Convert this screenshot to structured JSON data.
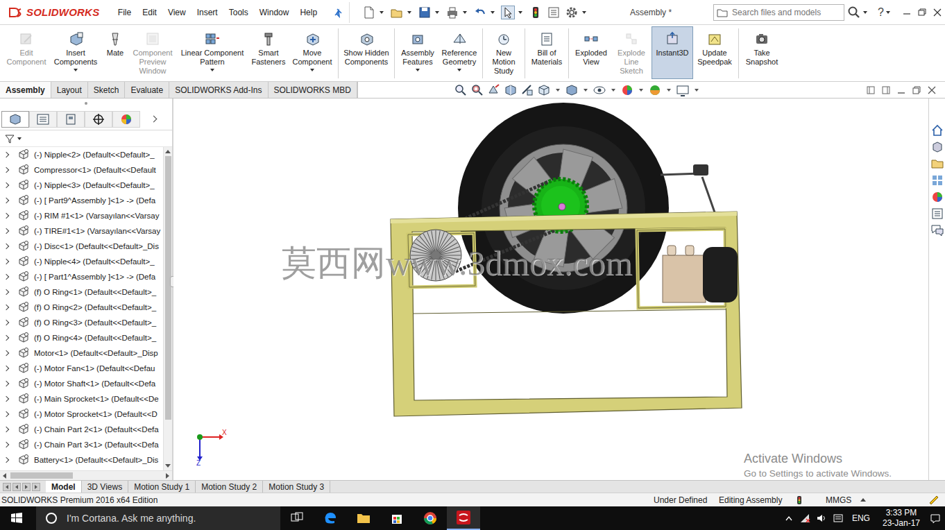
{
  "app": {
    "logo": "SOLIDWORKS",
    "title": "Assembly *",
    "help": "?"
  },
  "menu": [
    "File",
    "Edit",
    "View",
    "Insert",
    "Tools",
    "Window",
    "Help"
  ],
  "search": {
    "placeholder": "Search files and models"
  },
  "command_manager": [
    {
      "label": "Edit Component",
      "disabled": true,
      "selected": false,
      "has_menu": false
    },
    {
      "label": "Insert Components",
      "disabled": false,
      "selected": false,
      "has_menu": true
    },
    {
      "label": "Mate",
      "disabled": false,
      "selected": false,
      "has_menu": false
    },
    {
      "label": "Component Preview Window",
      "disabled": true,
      "selected": false,
      "has_menu": false
    },
    {
      "label": "Linear Component Pattern",
      "disabled": false,
      "selected": false,
      "has_menu": true
    },
    {
      "label": "Smart Fasteners",
      "disabled": false,
      "selected": false,
      "has_menu": false
    },
    {
      "label": "Move Component",
      "disabled": false,
      "selected": false,
      "has_menu": true
    },
    {
      "label": "Show Hidden Components",
      "disabled": false,
      "selected": false,
      "has_menu": false
    },
    {
      "label": "Assembly Features",
      "disabled": false,
      "selected": false,
      "has_menu": true
    },
    {
      "label": "Reference Geometry",
      "disabled": false,
      "selected": false,
      "has_menu": true
    },
    {
      "label": "New Motion Study",
      "disabled": false,
      "selected": false,
      "has_menu": false
    },
    {
      "label": "Bill of Materials",
      "disabled": false,
      "selected": false,
      "has_menu": false
    },
    {
      "label": "Exploded View",
      "disabled": false,
      "selected": false,
      "has_menu": false
    },
    {
      "label": "Explode Line Sketch",
      "disabled": true,
      "selected": false,
      "has_menu": false
    },
    {
      "label": "Instant3D",
      "disabled": false,
      "selected": true,
      "has_menu": false
    },
    {
      "label": "Update Speedpak",
      "disabled": false,
      "selected": false,
      "has_menu": false
    },
    {
      "label": "Take Snapshot",
      "disabled": false,
      "selected": false,
      "has_menu": false
    }
  ],
  "tabs": [
    {
      "label": "Assembly",
      "selected": true
    },
    {
      "label": "Layout",
      "selected": false
    },
    {
      "label": "Sketch",
      "selected": false
    },
    {
      "label": "Evaluate",
      "selected": false
    },
    {
      "label": "SOLIDWORKS Add-Ins",
      "selected": false
    },
    {
      "label": "SOLIDWORKS MBD",
      "selected": false
    }
  ],
  "panel_tabs": [
    {
      "selected": true
    },
    {
      "selected": false
    },
    {
      "selected": false
    },
    {
      "selected": false
    },
    {
      "selected": false
    }
  ],
  "tree": [
    {
      "label": "(-) Nipple<2> (Default<<Default>_",
      "expanded": false
    },
    {
      "label": "Compressor<1> (Default<<Default",
      "expanded": false
    },
    {
      "label": "(-) Nipple<3> (Default<<Default>_",
      "expanded": false
    },
    {
      "label": "(-) [ Part9^Assembly ]<1> -> (Defa",
      "expanded": false
    },
    {
      "label": "(-) RIM #1<1> (Varsayılan<<Varsay",
      "expanded": false
    },
    {
      "label": "(-) TIRE#1<1> (Varsayılan<<Varsay",
      "expanded": false
    },
    {
      "label": "(-) Disc<1> (Default<<Default>_Dis",
      "expanded": false
    },
    {
      "label": "(-) Nipple<4> (Default<<Default>_",
      "expanded": false
    },
    {
      "label": "(-) [ Part1^Assembly ]<1> -> (Defa",
      "expanded": false
    },
    {
      "label": "(f) O Ring<1> (Default<<Default>_",
      "expanded": false
    },
    {
      "label": "(f) O Ring<2> (Default<<Default>_",
      "expanded": false
    },
    {
      "label": "(f) O Ring<3> (Default<<Default>_",
      "expanded": false
    },
    {
      "label": "(f) O Ring<4> (Default<<Default>_",
      "expanded": false
    },
    {
      "label": "Motor<1> (Default<<Default>_Disp",
      "expanded": false
    },
    {
      "label": "(-) Motor Fan<1> (Default<<Defau",
      "expanded": false
    },
    {
      "label": "(-) Motor Shaft<1> (Default<<Defa",
      "expanded": false
    },
    {
      "label": "(-) Main Sprocket<1> (Default<<De",
      "expanded": false
    },
    {
      "label": "(-) Motor Sprocket<1> (Default<<D",
      "expanded": false
    },
    {
      "label": "(-) Chain Part 2<1> (Default<<Defa",
      "expanded": false
    },
    {
      "label": "(-) Chain Part 3<1> (Default<<Defa",
      "expanded": false
    },
    {
      "label": "Battery<1> (Default<<Default>_Dis",
      "expanded": false
    }
  ],
  "viewport": {
    "watermark": "莫西网www.3dmox.com",
    "triad": {
      "x": "X",
      "z": "Z"
    }
  },
  "activation": {
    "title": "Activate Windows",
    "subtitle": "Go to Settings to activate Windows."
  },
  "bottom_tabs": [
    {
      "label": "Model",
      "selected": true
    },
    {
      "label": "3D Views",
      "selected": false
    },
    {
      "label": "Motion Study 1",
      "selected": false
    },
    {
      "label": "Motion Study 2",
      "selected": false
    },
    {
      "label": "Motion Study 3",
      "selected": false
    }
  ],
  "status_bar": {
    "edition": "SOLIDWORKS Premium 2016 x64 Edition",
    "state": "Under Defined",
    "mode": "Editing Assembly",
    "units": "MMGS"
  },
  "taskbar": {
    "search": "I'm Cortana. Ask me anything.",
    "language": "ENG",
    "time": "3:33 PM",
    "date": "23-Jan-17"
  }
}
